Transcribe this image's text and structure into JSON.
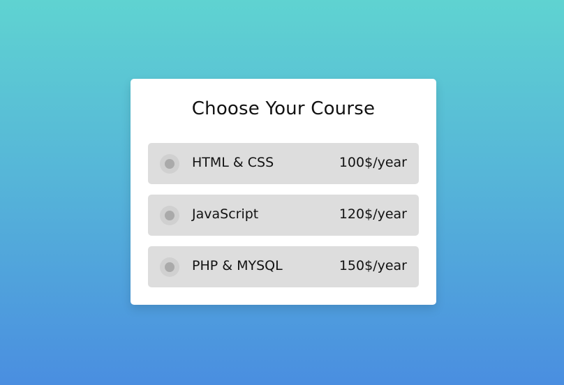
{
  "card": {
    "title": "Choose Your Course",
    "options": [
      {
        "label": "HTML & CSS",
        "price": "100$/year",
        "selected": false
      },
      {
        "label": "JavaScript",
        "price": "120$/year",
        "selected": false
      },
      {
        "label": "PHP & MYSQL",
        "price": "150$/year",
        "selected": false
      }
    ]
  },
  "colors": {
    "background_top": "#5fd3d1",
    "background_bottom": "#4a8ee0",
    "card": "#ffffff",
    "option_bg": "#dddddd",
    "radio_outer": "#d0d0d0",
    "radio_inner": "#aaaaaa"
  }
}
